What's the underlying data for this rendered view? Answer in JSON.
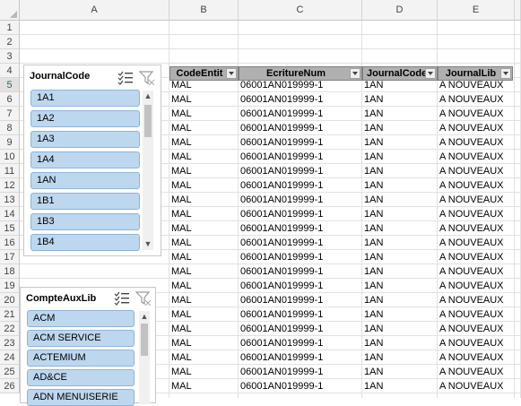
{
  "columns": [
    "A",
    "B",
    "C",
    "D",
    "E"
  ],
  "rows": [
    "1",
    "2",
    "3",
    "4",
    "5",
    "6",
    "7",
    "8",
    "9",
    "10",
    "11",
    "12",
    "13",
    "14",
    "15",
    "16",
    "17",
    "18",
    "19",
    "20",
    "21",
    "22",
    "23",
    "24",
    "25",
    "26"
  ],
  "table": {
    "headers": [
      "CodeEntit",
      "EcritureNum",
      "JournalCode",
      "JournalLib"
    ],
    "rows": [
      [
        "MAL",
        "06001AN019999-1",
        "1AN",
        "A NOUVEAUX"
      ],
      [
        "MAL",
        "06001AN019999-1",
        "1AN",
        "A NOUVEAUX"
      ],
      [
        "MAL",
        "06001AN019999-1",
        "1AN",
        "A NOUVEAUX"
      ],
      [
        "MAL",
        "06001AN019999-1",
        "1AN",
        "A NOUVEAUX"
      ],
      [
        "MAL",
        "06001AN019999-1",
        "1AN",
        "A NOUVEAUX"
      ],
      [
        "MAL",
        "06001AN019999-1",
        "1AN",
        "A NOUVEAUX"
      ],
      [
        "MAL",
        "06001AN019999-1",
        "1AN",
        "A NOUVEAUX"
      ],
      [
        "MAL",
        "06001AN019999-1",
        "1AN",
        "A NOUVEAUX"
      ],
      [
        "MAL",
        "06001AN019999-1",
        "1AN",
        "A NOUVEAUX"
      ],
      [
        "MAL",
        "06001AN019999-1",
        "1AN",
        "A NOUVEAUX"
      ],
      [
        "MAL",
        "06001AN019999-1",
        "1AN",
        "A NOUVEAUX"
      ],
      [
        "MAL",
        "06001AN019999-1",
        "1AN",
        "A NOUVEAUX"
      ],
      [
        "MAL",
        "06001AN019999-1",
        "1AN",
        "A NOUVEAUX"
      ],
      [
        "MAL",
        "06001AN019999-1",
        "1AN",
        "A NOUVEAUX"
      ],
      [
        "MAL",
        "06001AN019999-1",
        "1AN",
        "A NOUVEAUX"
      ],
      [
        "MAL",
        "06001AN019999-1",
        "1AN",
        "A NOUVEAUX"
      ],
      [
        "MAL",
        "06001AN019999-1",
        "1AN",
        "A NOUVEAUX"
      ],
      [
        "MAL",
        "06001AN019999-1",
        "1AN",
        "A NOUVEAUX"
      ],
      [
        "MAL",
        "06001AN019999-1",
        "1AN",
        "A NOUVEAUX"
      ],
      [
        "MAL",
        "06001AN019999-1",
        "1AN",
        "A NOUVEAUX"
      ],
      [
        "MAL",
        "06001AN019999-1",
        "1AN",
        "A NOUVEAUX"
      ],
      [
        "MAL",
        "06001AN019999-1",
        "1AN",
        "A NOUVEAUX"
      ]
    ]
  },
  "slicers": [
    {
      "title": "JournalCode",
      "items": [
        "1A1",
        "1A2",
        "1A3",
        "1A4",
        "1AN",
        "1B1",
        "1B3",
        "1B4"
      ]
    },
    {
      "title": "CompteAuxLib",
      "items": [
        "ACM",
        "ACM SERVICE",
        "ACTEMIUM",
        "AD&CE",
        "ADN MENUISERIE"
      ]
    }
  ],
  "icons": {
    "multiselect": "multi-select-icon",
    "clearfilter": "clear-filter-icon"
  },
  "colors": {
    "slicer_item_fill": "#bdd7ee",
    "slicer_item_border": "#8fb3d9",
    "table_header_fill": "#b0b0b0",
    "selected_row_header": "#e1e1e1"
  }
}
